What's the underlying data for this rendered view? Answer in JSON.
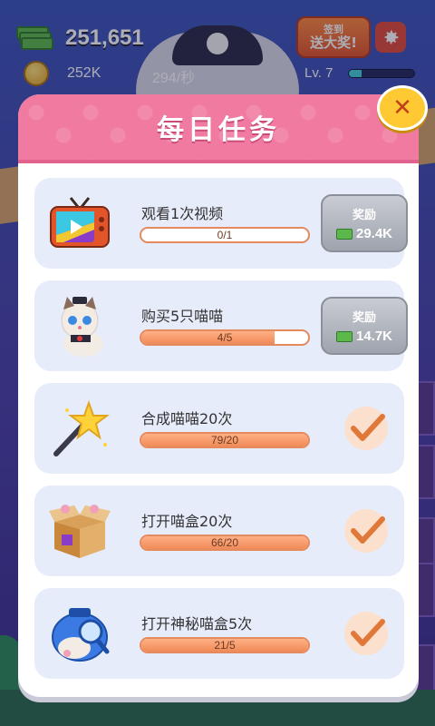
{
  "hud": {
    "money": "251,651",
    "coins": "252K",
    "rate": "294/秒",
    "level_label": "Lv. 7",
    "level_progress": 0.2,
    "signin_line1": "签到",
    "signin_line2": "送大奖!"
  },
  "modal": {
    "title": "每日任务",
    "tasks": [
      {
        "name": "观看1次视频",
        "progress_text": "0/1",
        "progress": 0.0,
        "state": "reward",
        "reward_label": "奖励",
        "reward_amount": "29.4K",
        "icon": "tv-icon"
      },
      {
        "name": "购买5只喵喵",
        "progress_text": "4/5",
        "progress": 0.8,
        "state": "reward",
        "reward_label": "奖励",
        "reward_amount": "14.7K",
        "icon": "cat-icon"
      },
      {
        "name": "合成喵喵20次",
        "progress_text": "79/20",
        "progress": 1.0,
        "state": "done",
        "icon": "magic-wand-icon"
      },
      {
        "name": "打开喵盒20次",
        "progress_text": "66/20",
        "progress": 1.0,
        "state": "done",
        "icon": "cat-box-icon"
      },
      {
        "name": "打开神秘喵盒5次",
        "progress_text": "21/5",
        "progress": 1.0,
        "state": "done",
        "icon": "mystery-cat-box-icon"
      }
    ]
  },
  "colors": {
    "header_pink": "#f07aa0",
    "card_bg": "#e7ecfb",
    "progress_orange": "#f08a58",
    "check_orange": "#e0783a",
    "close_yellow": "#ffc933"
  }
}
